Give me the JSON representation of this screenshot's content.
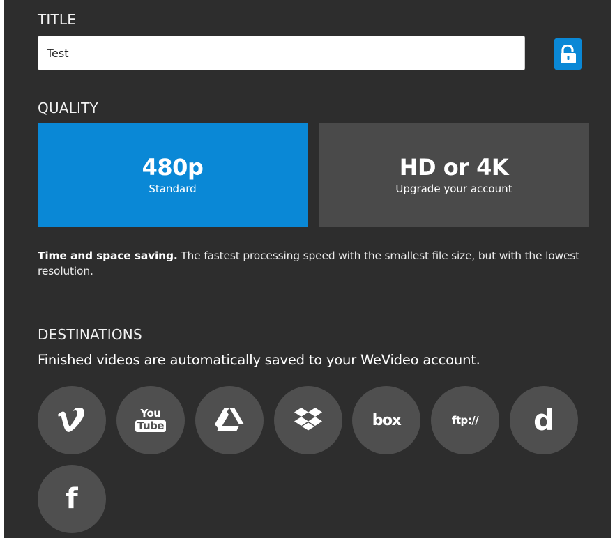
{
  "title_section": {
    "heading": "TITLE",
    "value": "Test",
    "lock_icon": "unlock-icon"
  },
  "quality_section": {
    "heading": "QUALITY",
    "options": [
      {
        "main": "480p",
        "sub": "Standard",
        "selected": true
      },
      {
        "main": "HD or 4K",
        "sub": "Upgrade your account",
        "selected": false
      }
    ],
    "description_bold": "Time and space saving.",
    "description_rest": " The fastest processing speed with the smallest file size, but with the lowest resolution."
  },
  "destinations_section": {
    "heading": "DESTINATIONS",
    "note": "Finished videos are automatically saved to your WeVideo account.",
    "items": [
      {
        "name": "vimeo",
        "icon": "vimeo-icon"
      },
      {
        "name": "youtube",
        "icon": "youtube-icon",
        "text_top": "You",
        "text_bottom": "Tube"
      },
      {
        "name": "google-drive",
        "icon": "google-drive-icon"
      },
      {
        "name": "dropbox",
        "icon": "dropbox-icon"
      },
      {
        "name": "box",
        "icon": "box-icon",
        "text": "box"
      },
      {
        "name": "ftp",
        "icon": "ftp-icon",
        "text": "ftp://"
      },
      {
        "name": "dailymotion",
        "icon": "dailymotion-icon",
        "text": "d"
      },
      {
        "name": "facebook",
        "icon": "facebook-icon",
        "text": "f"
      }
    ]
  },
  "colors": {
    "panel_background": "#2d2d2d",
    "accent": "#0a88d6",
    "unselected_option": "#4a4a4a",
    "destination_circle": "#4f4f4f"
  }
}
